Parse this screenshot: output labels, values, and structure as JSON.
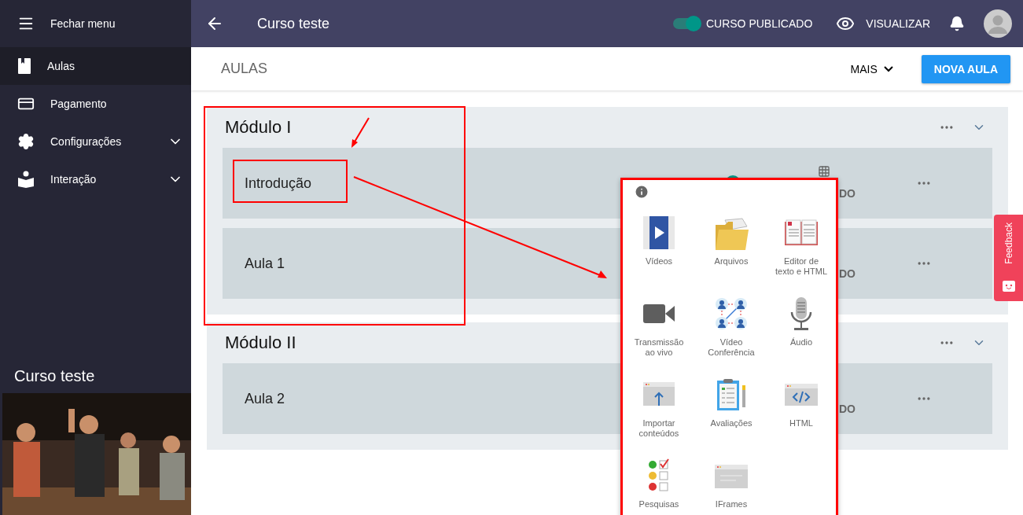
{
  "sidebar": {
    "close_menu": "Fechar menu",
    "items": [
      {
        "label": "Aulas",
        "kind": "book",
        "selected": true,
        "expandable": false
      },
      {
        "label": "Pagamento",
        "kind": "card",
        "selected": false,
        "expandable": false
      },
      {
        "label": "Configurações",
        "kind": "gear",
        "selected": false,
        "expandable": true
      },
      {
        "label": "Interação",
        "kind": "reader",
        "selected": false,
        "expandable": true
      }
    ],
    "course_title": "Curso teste"
  },
  "topbar": {
    "title": "Curso teste",
    "published": {
      "on": true,
      "label": "CURSO PUBLICADO"
    },
    "preview": "VISUALIZAR"
  },
  "toolbar": {
    "title": "AULAS",
    "more": "MAIS",
    "new_lesson": "NOVA AULA"
  },
  "modules": [
    {
      "title": "Módulo I",
      "highlighted": true,
      "lessons": [
        {
          "title": "Introdução",
          "highlighted": true,
          "published": true,
          "status_fragment": "DO"
        },
        {
          "title": "Aula 1",
          "highlighted": false,
          "status_fragment": "DO"
        }
      ]
    },
    {
      "title": "Módulo II",
      "highlighted": false,
      "lessons": [
        {
          "title": "Aula 2",
          "highlighted": false,
          "status_fragment": "DO"
        }
      ]
    }
  ],
  "content_menu": {
    "items": [
      {
        "label": "Vídeos",
        "kind": "videos"
      },
      {
        "label": "Arquivos",
        "kind": "files"
      },
      {
        "label": "Editor de texto e HTML",
        "kind": "editor"
      },
      {
        "label": "Transmissão ao vivo",
        "kind": "live"
      },
      {
        "label": "Vídeo Conferência",
        "kind": "conference"
      },
      {
        "label": "Áudio",
        "kind": "audio"
      },
      {
        "label": "Importar conteúdos",
        "kind": "import"
      },
      {
        "label": "Avaliações",
        "kind": "quiz"
      },
      {
        "label": "HTML",
        "kind": "html"
      },
      {
        "label": "Pesquisas",
        "kind": "survey"
      },
      {
        "label": "IFrames",
        "kind": "iframe"
      }
    ]
  },
  "feedback": "Feedback"
}
